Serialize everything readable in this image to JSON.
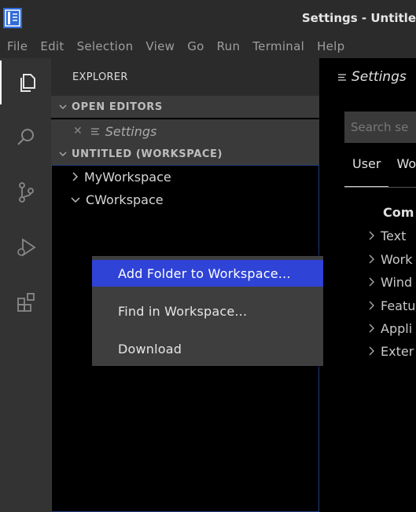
{
  "titlebar": {
    "title": "Settings - Untitle"
  },
  "menubar": {
    "items": [
      "File",
      "Edit",
      "Selection",
      "View",
      "Go",
      "Run",
      "Terminal",
      "Help"
    ]
  },
  "activitybar": {
    "items": [
      "explorer-icon",
      "search-icon",
      "source-control-icon",
      "run-debug-icon",
      "extensions-icon"
    ]
  },
  "sidebar": {
    "title": "EXPLORER",
    "open_editors": {
      "label": "OPEN EDITORS",
      "items": [
        {
          "label": "Settings"
        }
      ]
    },
    "workspace": {
      "label": "UNTITLED (WORKSPACE)",
      "folders": [
        {
          "label": "MyWorkspace",
          "expanded": false
        },
        {
          "label": "CWorkspace",
          "expanded": true
        }
      ]
    }
  },
  "editor": {
    "tab_label": "Settings",
    "search_placeholder": "Search se",
    "scope_tabs": [
      "User",
      "Wo"
    ],
    "category_title": "Com",
    "categories": [
      "Text",
      "Work",
      "Wind",
      "Featu",
      "Appli",
      "Exter"
    ]
  },
  "context_menu": {
    "items": [
      "Add Folder to Workspace...",
      "Find in Workspace...",
      "Download"
    ],
    "highlighted_index": 0
  },
  "colors": {
    "highlight": "#2f43d6",
    "chrome": "#2b2b2b",
    "activitybar": "#333333"
  }
}
